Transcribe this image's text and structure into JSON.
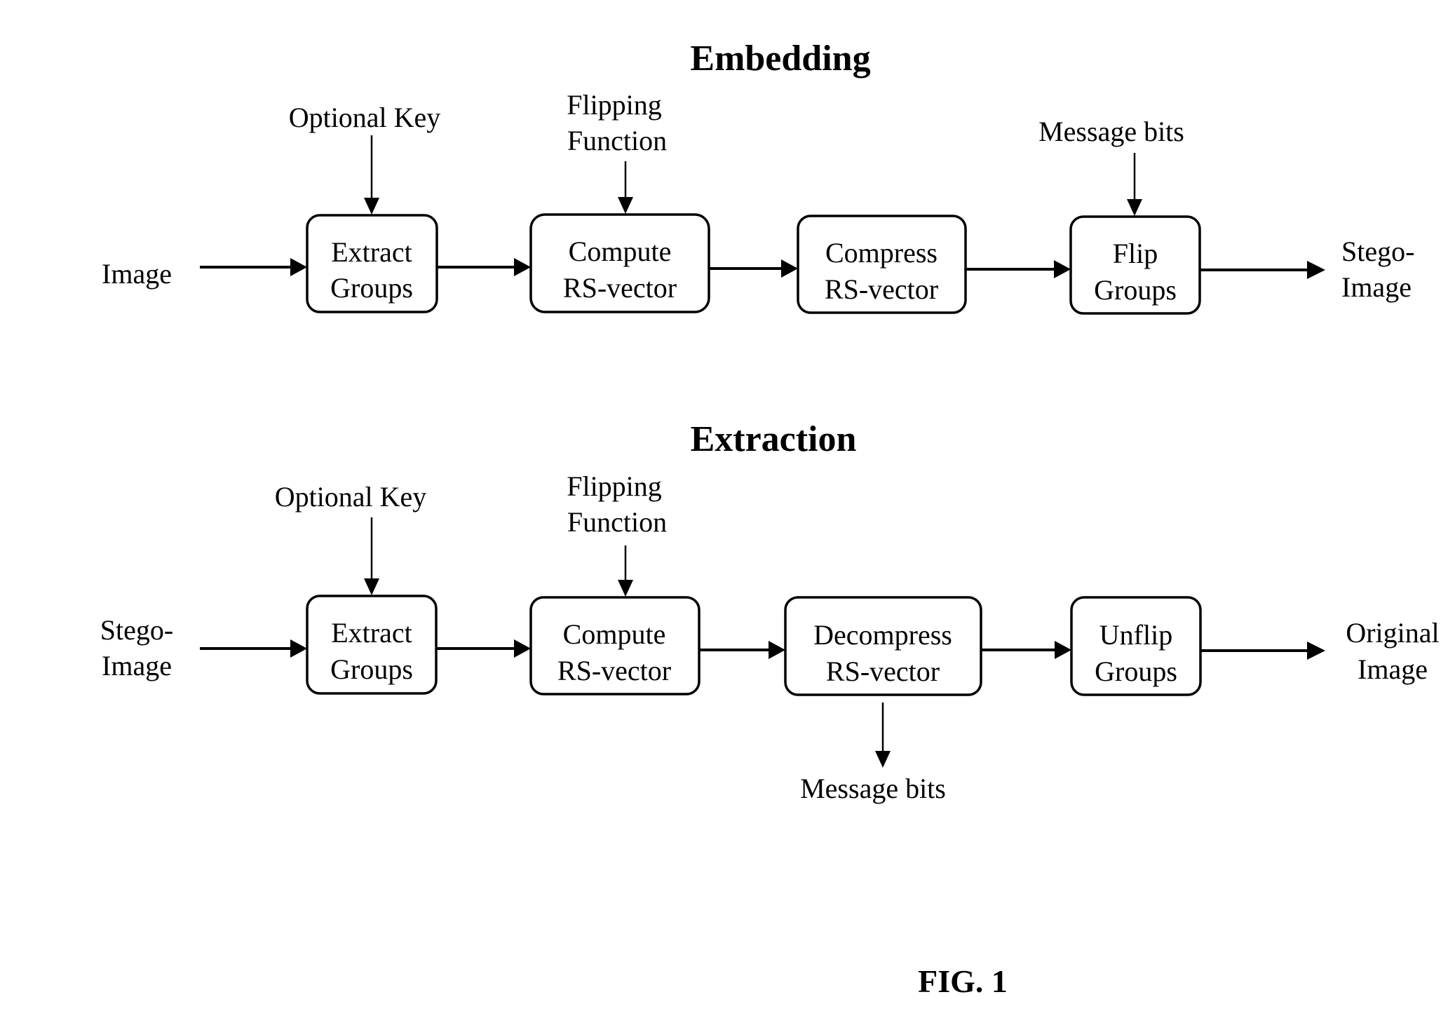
{
  "embedding": {
    "title": "Embedding",
    "input_label": [
      "Image"
    ],
    "output_label": [
      "Stego-",
      "Image"
    ],
    "boxes": [
      {
        "lines": [
          "Extract",
          "Groups"
        ],
        "input_above": [
          "Optional Key"
        ]
      },
      {
        "lines": [
          "Compute",
          "RS-vector"
        ],
        "input_above": [
          "Flipping",
          "Function"
        ]
      },
      {
        "lines": [
          "Compress",
          "RS-vector"
        ],
        "input_above": []
      },
      {
        "lines": [
          "Flip",
          "Groups"
        ],
        "input_above": [
          "Message bits"
        ]
      }
    ]
  },
  "extraction": {
    "title": "Extraction",
    "input_label": [
      "Stego-",
      "Image"
    ],
    "output_label": [
      "Original",
      "Image"
    ],
    "boxes": [
      {
        "lines": [
          "Extract",
          "Groups"
        ],
        "input_above": [
          "Optional Key"
        ]
      },
      {
        "lines": [
          "Compute",
          "RS-vector"
        ],
        "input_above": [
          "Flipping",
          "Function"
        ]
      },
      {
        "lines": [
          "Decompress",
          "RS-vector"
        ],
        "input_above": [],
        "output_below": [
          "Message bits"
        ]
      },
      {
        "lines": [
          "Unflip",
          "Groups"
        ],
        "input_above": []
      }
    ]
  },
  "figure_label": "FIG. 1"
}
